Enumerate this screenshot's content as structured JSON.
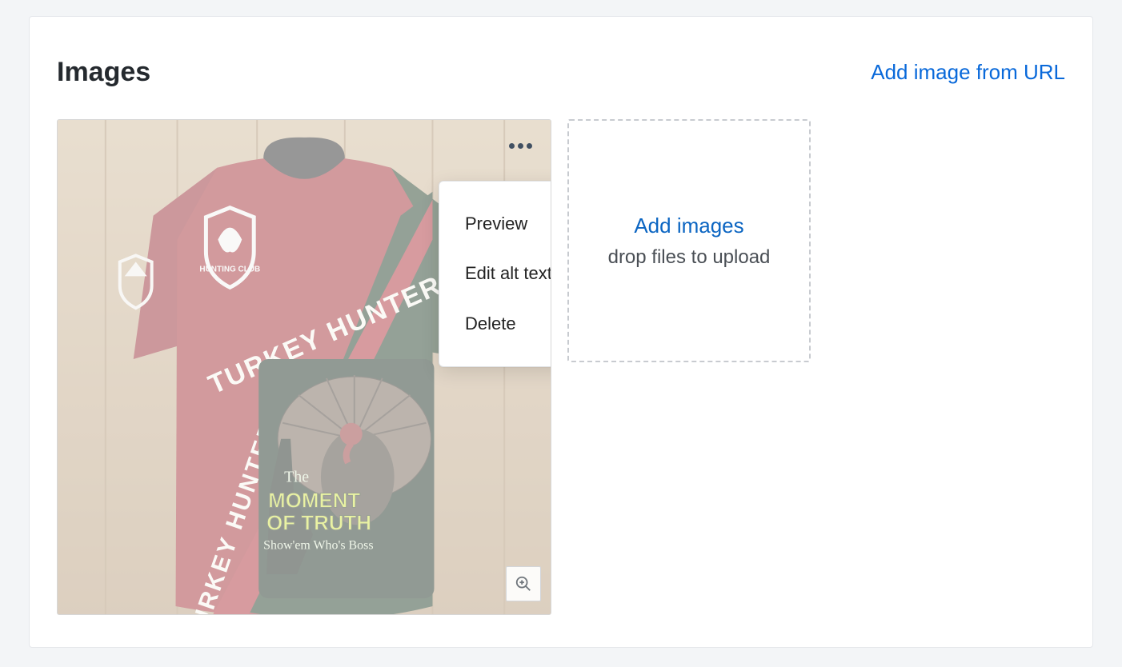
{
  "section": {
    "title": "Images",
    "add_from_url_label": "Add image from URL"
  },
  "image_tile": {
    "product": {
      "shirt_text_top": "TURKEY HUNTER",
      "shirt_text_side": "TURKEY HUNTER",
      "badge_line1": "HUNTING CLUB",
      "graphic_line1": "The",
      "graphic_line2": "MOMENT",
      "graphic_line3": "OF TRUTH",
      "graphic_line4": "Show'em Who's Boss"
    }
  },
  "context_menu": {
    "items": [
      "Preview",
      "Edit alt text",
      "Delete"
    ]
  },
  "upload_tile": {
    "add_images_label": "Add images",
    "drop_text": "drop files to upload"
  }
}
